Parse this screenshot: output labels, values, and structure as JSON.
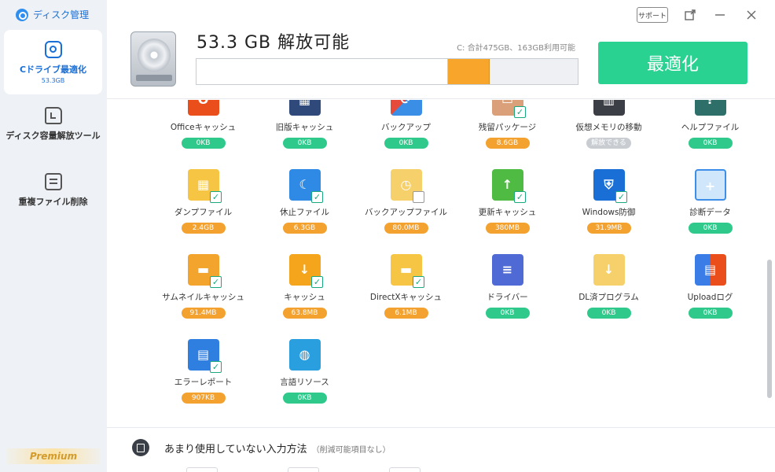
{
  "app": {
    "title": "ディスク管理"
  },
  "sidebar": {
    "items": [
      {
        "label": "Cドライブ最適化",
        "sub": "53.3GB",
        "icon": "disk-search-icon"
      },
      {
        "label": "ディスク容量解放ツール",
        "icon": "folder-icon"
      },
      {
        "label": "重複ファイル削除",
        "icon": "copy-icon"
      }
    ],
    "premium": "Premium"
  },
  "header": {
    "support": "サポート",
    "free_amount": "53.3 GB  解放可能",
    "usage": "C: 合計475GB、163GB利用可能",
    "usage_bar": {
      "used_fraction": 0.657,
      "freeable_fraction": 0.109
    },
    "optimize": "最適化",
    "colors": {
      "accent": "#29d291",
      "freeable": "#f7a52b"
    }
  },
  "items": [
    {
      "name": "Officeキャッシュ",
      "size": "0KB",
      "size_color": "green",
      "icon": "office-icon"
    },
    {
      "name": "旧版キャッシュ",
      "size": "0KB",
      "size_color": "green",
      "icon": "windows-old-icon"
    },
    {
      "name": "バックアップ",
      "size": "0KB",
      "size_color": "green",
      "icon": "backup-icon"
    },
    {
      "name": "残留パッケージ",
      "size": "8.6GB",
      "size_color": "orange",
      "checked": true,
      "icon": "package-icon"
    },
    {
      "name": "仮想メモリの移動",
      "size": "解放できる",
      "size_color": "grey",
      "icon": "memory-icon"
    },
    {
      "name": "ヘルプファイル",
      "size": "0KB",
      "size_color": "green",
      "icon": "help-file-icon"
    },
    {
      "name": "ダンプファイル",
      "size": "2.4GB",
      "size_color": "orange",
      "checked": true,
      "icon": "dump-file-icon"
    },
    {
      "name": "休止ファイル",
      "size": "6.3GB",
      "size_color": "orange",
      "checked": true,
      "icon": "hibernate-file-icon"
    },
    {
      "name": "バックアップファイル",
      "size": "80.0MB",
      "size_color": "orange",
      "checked": false,
      "icon": "backup-file-icon"
    },
    {
      "name": "更新キャッシュ",
      "size": "380MB",
      "size_color": "orange",
      "checked": true,
      "icon": "update-cache-icon"
    },
    {
      "name": "Windows防御",
      "size": "31.9MB",
      "size_color": "orange",
      "checked": true,
      "icon": "shield-icon"
    },
    {
      "name": "診断データ",
      "size": "0KB",
      "size_color": "green",
      "icon": "diagnostic-icon"
    },
    {
      "name": "サムネイルキャッシュ",
      "size": "91.4MB",
      "size_color": "orange",
      "checked": true,
      "icon": "thumbnail-icon"
    },
    {
      "name": "キャッシュ",
      "size": "63.8MB",
      "size_color": "orange",
      "checked": true,
      "icon": "cache-icon"
    },
    {
      "name": "DirectXキャッシュ",
      "size": "6.1MB",
      "size_color": "orange",
      "checked": true,
      "icon": "directx-icon"
    },
    {
      "name": "ドライバー",
      "size": "0KB",
      "size_color": "green",
      "icon": "driver-icon"
    },
    {
      "name": "DL済プログラム",
      "size": "0KB",
      "size_color": "green",
      "icon": "download-program-icon"
    },
    {
      "name": "Uploadログ",
      "size": "0KB",
      "size_color": "green",
      "icon": "upload-log-icon"
    },
    {
      "name": "エラーレポート",
      "size": "907KB",
      "size_color": "orange",
      "checked": true,
      "icon": "error-report-icon"
    },
    {
      "name": "言語リソース",
      "size": "0KB",
      "size_color": "green",
      "icon": "globe-icon"
    }
  ],
  "bottom": {
    "title": "あまり使用していない入力方法",
    "note": "（削減可能項目なし）"
  }
}
